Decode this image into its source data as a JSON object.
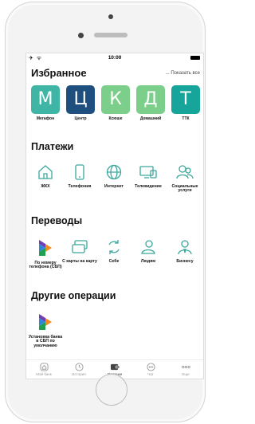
{
  "status_bar": {
    "left": "✈ ᯤ",
    "time": "10:00"
  },
  "favorites": {
    "title": "Избранное",
    "show_all": "... Показать все",
    "items": [
      {
        "letter": "М",
        "label": "Мегафон",
        "color": "#3fb5a6"
      },
      {
        "letter": "Ц",
        "label": "Центр",
        "color": "#1f4f7e"
      },
      {
        "letter": "К",
        "label": "Ксюше",
        "color": "#7ccf8a"
      },
      {
        "letter": "Д",
        "label": "Домашний",
        "color": "#7ccf8a"
      },
      {
        "letter": "Т",
        "label": "ТТК",
        "color": "#17a49a"
      }
    ]
  },
  "payments": {
    "title": "Платежи",
    "items": [
      {
        "icon": "house-icon",
        "label": "ЖКХ"
      },
      {
        "icon": "phone-icon",
        "label": "Телефония"
      },
      {
        "icon": "globe-icon",
        "label": "Интернет"
      },
      {
        "icon": "tv-icon",
        "label": "Телевидение"
      },
      {
        "icon": "people-icon",
        "label": "Социальные услуги"
      }
    ]
  },
  "transfers": {
    "title": "Переводы",
    "items": [
      {
        "icon": "sbp-logo-icon",
        "label": "По номеру телефона (СБП)"
      },
      {
        "icon": "cards-icon",
        "label": "С карты на карту"
      },
      {
        "icon": "refresh-icon",
        "label": "Себе"
      },
      {
        "icon": "person-icon",
        "label": "Людям"
      },
      {
        "icon": "business-person-icon",
        "label": "Бизнесу"
      }
    ]
  },
  "other": {
    "title": "Другие операции",
    "items": [
      {
        "icon": "sbp-logo-icon",
        "label": "Установка банка в СБП по умолчанию"
      }
    ]
  },
  "tabbar": {
    "items": [
      {
        "label": "Мой банк",
        "icon": "home-tab-icon",
        "active": false
      },
      {
        "label": "История",
        "icon": "clock-icon",
        "active": false
      },
      {
        "label": "Платежи",
        "icon": "wallet-icon",
        "active": true
      },
      {
        "label": "Чат",
        "icon": "chat-icon",
        "active": false
      },
      {
        "label": "Еще",
        "icon": "more-icon",
        "active": false
      }
    ]
  },
  "colors": {
    "accent": "#3fb5a6",
    "icon_stroke": "#3aa89c",
    "sbp_green": "#1e9e4f",
    "sbp_purple": "#6e3fb3",
    "sbp_orange": "#f28c1e",
    "sbp_blue": "#2d87d8"
  }
}
